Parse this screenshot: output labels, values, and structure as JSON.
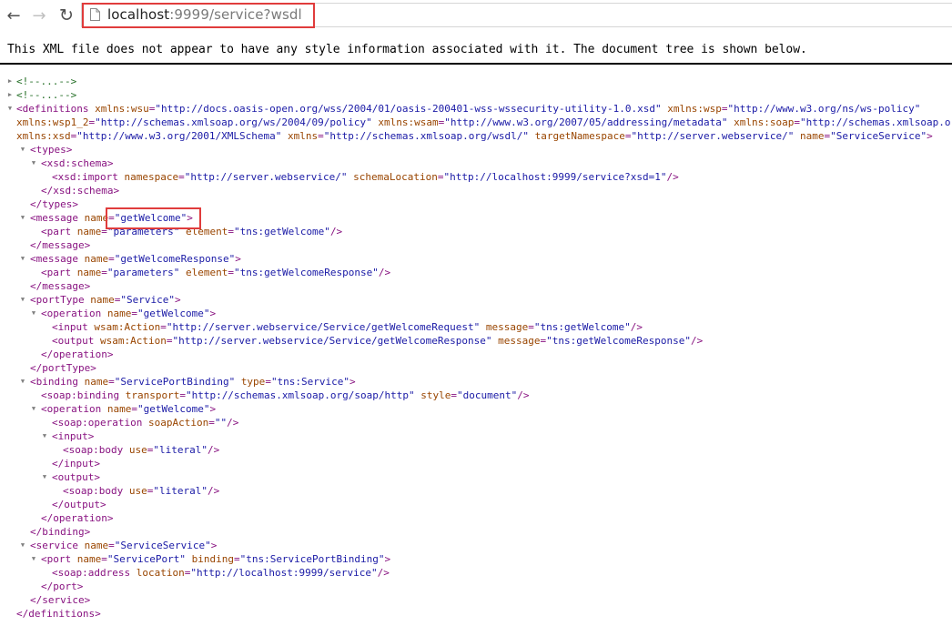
{
  "browser": {
    "url_host": "localhost",
    "url_rest": ":9999/service?wsdl",
    "back_glyph": "←",
    "forward_glyph": "→",
    "reload_glyph": "↻"
  },
  "banner": "This XML file does not appear to have any style information associated with it. The document tree is shown below.",
  "colors": {
    "highlight": "#e03c3c",
    "tag": "#881280",
    "attr_name": "#994500",
    "attr_value": "#1a1aa6"
  },
  "lines": [
    {
      "toggle": "collapsed",
      "parts": [
        {
          "t": "cm",
          "v": "<!--...-->"
        }
      ]
    },
    {
      "toggle": "collapsed",
      "parts": [
        {
          "t": "cm",
          "v": "<!--...-->"
        }
      ]
    },
    {
      "toggle": "expanded",
      "parts": [
        {
          "t": "tag",
          "v": "<definitions "
        },
        {
          "t": "an",
          "v": "xmlns:wsu"
        },
        {
          "t": "tag",
          "v": "="
        },
        {
          "t": "av",
          "v": "\"http://docs.oasis-open.org/wss/2004/01/oasis-200401-wss-wssecurity-utility-1.0.xsd\""
        },
        {
          "t": "tag",
          "v": " "
        },
        {
          "t": "an",
          "v": "xmlns:wsp"
        },
        {
          "t": "tag",
          "v": "="
        },
        {
          "t": "av",
          "v": "\"http://www.w3.org/ns/ws-policy\""
        }
      ]
    },
    {
      "toggle": "none",
      "parts": [
        {
          "t": "an",
          "v": "xmlns:wsp1_2"
        },
        {
          "t": "tag",
          "v": "="
        },
        {
          "t": "av",
          "v": "\"http://schemas.xmlsoap.org/ws/2004/09/policy\""
        },
        {
          "t": "tag",
          "v": " "
        },
        {
          "t": "an",
          "v": "xmlns:wsam"
        },
        {
          "t": "tag",
          "v": "="
        },
        {
          "t": "av",
          "v": "\"http://www.w3.org/2007/05/addressing/metadata\""
        },
        {
          "t": "tag",
          "v": " "
        },
        {
          "t": "an",
          "v": "xmlns:soap"
        },
        {
          "t": "tag",
          "v": "="
        },
        {
          "t": "av",
          "v": "\"http://schemas.xmlsoap.org/"
        }
      ]
    },
    {
      "toggle": "none",
      "parts": [
        {
          "t": "an",
          "v": "xmlns:xsd"
        },
        {
          "t": "tag",
          "v": "="
        },
        {
          "t": "av",
          "v": "\"http://www.w3.org/2001/XMLSchema\""
        },
        {
          "t": "tag",
          "v": " "
        },
        {
          "t": "an",
          "v": "xmlns"
        },
        {
          "t": "tag",
          "v": "="
        },
        {
          "t": "av",
          "v": "\"http://schemas.xmlsoap.org/wsdl/\""
        },
        {
          "t": "tag",
          "v": " "
        },
        {
          "t": "an",
          "v": "targetNamespace"
        },
        {
          "t": "tag",
          "v": "="
        },
        {
          "t": "av",
          "v": "\"http://server.webservice/\""
        },
        {
          "t": "tag",
          "v": " "
        },
        {
          "t": "an",
          "v": "name"
        },
        {
          "t": "tag",
          "v": "="
        },
        {
          "t": "av",
          "v": "\"ServiceService\""
        },
        {
          "t": "tag",
          "v": ">"
        }
      ]
    },
    {
      "toggle": "expanded",
      "parts": [
        {
          "t": "tag",
          "v": "<types>"
        }
      ]
    },
    {
      "toggle": "expanded",
      "parts": [
        {
          "t": "tag",
          "v": "<xsd:schema>"
        }
      ]
    },
    {
      "toggle": "none",
      "parts": [
        {
          "t": "tag",
          "v": "<xsd:import "
        },
        {
          "t": "an",
          "v": "namespace"
        },
        {
          "t": "tag",
          "v": "="
        },
        {
          "t": "av",
          "v": "\"http://server.webservice/\""
        },
        {
          "t": "tag",
          "v": " "
        },
        {
          "t": "an",
          "v": "schemaLocation"
        },
        {
          "t": "tag",
          "v": "="
        },
        {
          "t": "av",
          "v": "\"http://localhost:9999/service?xsd=1\""
        },
        {
          "t": "tag",
          "v": "/>"
        }
      ]
    },
    {
      "toggle": "none",
      "parts": [
        {
          "t": "tag",
          "v": "</xsd:schema>"
        }
      ]
    },
    {
      "toggle": "none",
      "parts": [
        {
          "t": "tag",
          "v": "</types>"
        }
      ]
    },
    {
      "toggle": "expanded",
      "parts": [
        {
          "t": "tag",
          "v": "<message "
        },
        {
          "t": "an",
          "v": "name"
        },
        {
          "t": "tag",
          "v": "="
        },
        {
          "t": "av",
          "v": "\"getWelcome\""
        },
        {
          "t": "tag",
          "v": ">"
        }
      ]
    },
    {
      "toggle": "none",
      "parts": [
        {
          "t": "tag",
          "v": "<part "
        },
        {
          "t": "an",
          "v": "name"
        },
        {
          "t": "tag",
          "v": "="
        },
        {
          "t": "av",
          "v": "\"parameters\""
        },
        {
          "t": "tag",
          "v": " "
        },
        {
          "t": "an",
          "v": "element"
        },
        {
          "t": "tag",
          "v": "="
        },
        {
          "t": "av",
          "v": "\"tns:getWelcome\""
        },
        {
          "t": "tag",
          "v": "/>"
        }
      ]
    },
    {
      "toggle": "none",
      "parts": [
        {
          "t": "tag",
          "v": "</message>"
        }
      ]
    },
    {
      "toggle": "expanded",
      "parts": [
        {
          "t": "tag",
          "v": "<message "
        },
        {
          "t": "an",
          "v": "name"
        },
        {
          "t": "tag",
          "v": "="
        },
        {
          "t": "av",
          "v": "\"getWelcomeResponse\""
        },
        {
          "t": "tag",
          "v": ">"
        }
      ]
    },
    {
      "toggle": "none",
      "parts": [
        {
          "t": "tag",
          "v": "<part "
        },
        {
          "t": "an",
          "v": "name"
        },
        {
          "t": "tag",
          "v": "="
        },
        {
          "t": "av",
          "v": "\"parameters\""
        },
        {
          "t": "tag",
          "v": " "
        },
        {
          "t": "an",
          "v": "element"
        },
        {
          "t": "tag",
          "v": "="
        },
        {
          "t": "av",
          "v": "\"tns:getWelcomeResponse\""
        },
        {
          "t": "tag",
          "v": "/>"
        }
      ]
    },
    {
      "toggle": "none",
      "parts": [
        {
          "t": "tag",
          "v": "</message>"
        }
      ]
    },
    {
      "toggle": "expanded",
      "parts": [
        {
          "t": "tag",
          "v": "<portType "
        },
        {
          "t": "an",
          "v": "name"
        },
        {
          "t": "tag",
          "v": "="
        },
        {
          "t": "av",
          "v": "\"Service\""
        },
        {
          "t": "tag",
          "v": ">"
        }
      ]
    },
    {
      "toggle": "expanded",
      "parts": [
        {
          "t": "tag",
          "v": "<operation "
        },
        {
          "t": "an",
          "v": "name"
        },
        {
          "t": "tag",
          "v": "="
        },
        {
          "t": "av",
          "v": "\"getWelcome\""
        },
        {
          "t": "tag",
          "v": ">"
        }
      ]
    },
    {
      "toggle": "none",
      "parts": [
        {
          "t": "tag",
          "v": "<input "
        },
        {
          "t": "an",
          "v": "wsam:Action"
        },
        {
          "t": "tag",
          "v": "="
        },
        {
          "t": "av",
          "v": "\"http://server.webservice/Service/getWelcomeRequest\""
        },
        {
          "t": "tag",
          "v": " "
        },
        {
          "t": "an",
          "v": "message"
        },
        {
          "t": "tag",
          "v": "="
        },
        {
          "t": "av",
          "v": "\"tns:getWelcome\""
        },
        {
          "t": "tag",
          "v": "/>"
        }
      ]
    },
    {
      "toggle": "none",
      "parts": [
        {
          "t": "tag",
          "v": "<output "
        },
        {
          "t": "an",
          "v": "wsam:Action"
        },
        {
          "t": "tag",
          "v": "="
        },
        {
          "t": "av",
          "v": "\"http://server.webservice/Service/getWelcomeResponse\""
        },
        {
          "t": "tag",
          "v": " "
        },
        {
          "t": "an",
          "v": "message"
        },
        {
          "t": "tag",
          "v": "="
        },
        {
          "t": "av",
          "v": "\"tns:getWelcomeResponse\""
        },
        {
          "t": "tag",
          "v": "/>"
        }
      ]
    },
    {
      "toggle": "none",
      "parts": [
        {
          "t": "tag",
          "v": "</operation>"
        }
      ]
    },
    {
      "toggle": "none",
      "parts": [
        {
          "t": "tag",
          "v": "</portType>"
        }
      ]
    },
    {
      "toggle": "expanded",
      "parts": [
        {
          "t": "tag",
          "v": "<binding "
        },
        {
          "t": "an",
          "v": "name"
        },
        {
          "t": "tag",
          "v": "="
        },
        {
          "t": "av",
          "v": "\"ServicePortBinding\""
        },
        {
          "t": "tag",
          "v": " "
        },
        {
          "t": "an",
          "v": "type"
        },
        {
          "t": "tag",
          "v": "="
        },
        {
          "t": "av",
          "v": "\"tns:Service\""
        },
        {
          "t": "tag",
          "v": ">"
        }
      ]
    },
    {
      "toggle": "none",
      "parts": [
        {
          "t": "tag",
          "v": "<soap:binding "
        },
        {
          "t": "an",
          "v": "transport"
        },
        {
          "t": "tag",
          "v": "="
        },
        {
          "t": "av",
          "v": "\"http://schemas.xmlsoap.org/soap/http\""
        },
        {
          "t": "tag",
          "v": " "
        },
        {
          "t": "an",
          "v": "style"
        },
        {
          "t": "tag",
          "v": "="
        },
        {
          "t": "av",
          "v": "\"document\""
        },
        {
          "t": "tag",
          "v": "/>"
        }
      ]
    },
    {
      "toggle": "expanded",
      "parts": [
        {
          "t": "tag",
          "v": "<operation "
        },
        {
          "t": "an",
          "v": "name"
        },
        {
          "t": "tag",
          "v": "="
        },
        {
          "t": "av",
          "v": "\"getWelcome\""
        },
        {
          "t": "tag",
          "v": ">"
        }
      ]
    },
    {
      "toggle": "none",
      "parts": [
        {
          "t": "tag",
          "v": "<soap:operation "
        },
        {
          "t": "an",
          "v": "soapAction"
        },
        {
          "t": "tag",
          "v": "="
        },
        {
          "t": "av",
          "v": "\"\""
        },
        {
          "t": "tag",
          "v": "/>"
        }
      ]
    },
    {
      "toggle": "expanded",
      "parts": [
        {
          "t": "tag",
          "v": "<input>"
        }
      ]
    },
    {
      "toggle": "none",
      "parts": [
        {
          "t": "tag",
          "v": "<soap:body "
        },
        {
          "t": "an",
          "v": "use"
        },
        {
          "t": "tag",
          "v": "="
        },
        {
          "t": "av",
          "v": "\"literal\""
        },
        {
          "t": "tag",
          "v": "/>"
        }
      ]
    },
    {
      "toggle": "none",
      "parts": [
        {
          "t": "tag",
          "v": "</input>"
        }
      ]
    },
    {
      "toggle": "expanded",
      "parts": [
        {
          "t": "tag",
          "v": "<output>"
        }
      ]
    },
    {
      "toggle": "none",
      "parts": [
        {
          "t": "tag",
          "v": "<soap:body "
        },
        {
          "t": "an",
          "v": "use"
        },
        {
          "t": "tag",
          "v": "="
        },
        {
          "t": "av",
          "v": "\"literal\""
        },
        {
          "t": "tag",
          "v": "/>"
        }
      ]
    },
    {
      "toggle": "none",
      "parts": [
        {
          "t": "tag",
          "v": "</output>"
        }
      ]
    },
    {
      "toggle": "none",
      "parts": [
        {
          "t": "tag",
          "v": "</operation>"
        }
      ]
    },
    {
      "toggle": "none",
      "parts": [
        {
          "t": "tag",
          "v": "</binding>"
        }
      ]
    },
    {
      "toggle": "expanded",
      "parts": [
        {
          "t": "tag",
          "v": "<service "
        },
        {
          "t": "an",
          "v": "name"
        },
        {
          "t": "tag",
          "v": "="
        },
        {
          "t": "av",
          "v": "\"ServiceService\""
        },
        {
          "t": "tag",
          "v": ">"
        }
      ]
    },
    {
      "toggle": "expanded",
      "parts": [
        {
          "t": "tag",
          "v": "<port "
        },
        {
          "t": "an",
          "v": "name"
        },
        {
          "t": "tag",
          "v": "="
        },
        {
          "t": "av",
          "v": "\"ServicePort\""
        },
        {
          "t": "tag",
          "v": " "
        },
        {
          "t": "an",
          "v": "binding"
        },
        {
          "t": "tag",
          "v": "="
        },
        {
          "t": "av",
          "v": "\"tns:ServicePortBinding\""
        },
        {
          "t": "tag",
          "v": ">"
        }
      ]
    },
    {
      "toggle": "none",
      "parts": [
        {
          "t": "tag",
          "v": "<soap:address "
        },
        {
          "t": "an",
          "v": "location"
        },
        {
          "t": "tag",
          "v": "="
        },
        {
          "t": "av",
          "v": "\"http://localhost:9999/service\""
        },
        {
          "t": "tag",
          "v": "/>"
        }
      ]
    },
    {
      "toggle": "none",
      "parts": [
        {
          "t": "tag",
          "v": "</port>"
        }
      ]
    },
    {
      "toggle": "none",
      "parts": [
        {
          "t": "tag",
          "v": "</service>"
        }
      ]
    },
    {
      "toggle": "none",
      "parts": [
        {
          "t": "tag",
          "v": "</definitions>"
        }
      ]
    }
  ]
}
